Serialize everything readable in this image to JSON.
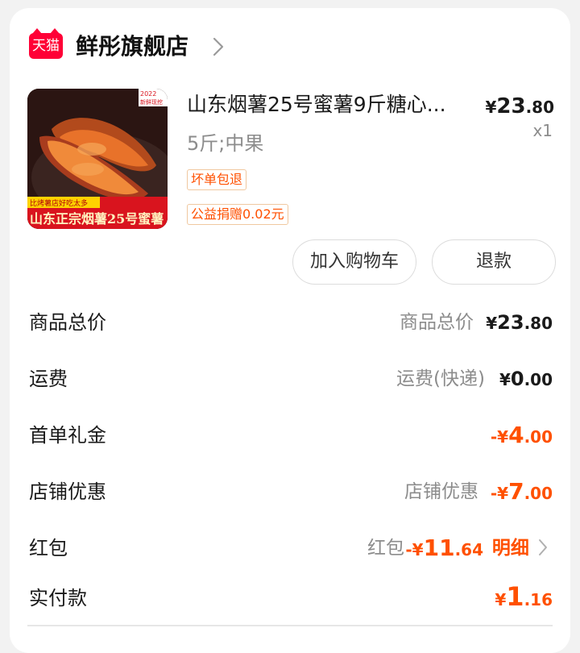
{
  "store": {
    "logo_text": "天猫",
    "name": "鲜彤旗舰店"
  },
  "item": {
    "thumb_year": "2022",
    "thumb_badge": "新鲜现挖",
    "thumb_banner_small": "比烤薯店好吃太多",
    "thumb_banner": "山东正宗烟薯25号蜜薯",
    "title": "山东烟薯25号蜜薯9斤糖心...",
    "spec": "5斤;中果",
    "tags": [
      "坏单包退",
      "公益捐赠0.02元"
    ],
    "price": {
      "sym": "¥",
      "int": "23",
      "dec": ".80"
    },
    "quantity": "x1"
  },
  "actions": {
    "add_to_cart": "加入购物车",
    "refund": "退款"
  },
  "summary": {
    "total": {
      "label": "商品总价",
      "sub": "商品总价",
      "sym": "¥",
      "int": "23",
      "dec": ".80"
    },
    "shipping": {
      "label": "运费",
      "sub": "运费(快递)",
      "sym": "¥",
      "int": "0",
      "dec": ".00"
    },
    "first_order": {
      "label": "首单礼金",
      "sym": "-¥",
      "int": "4",
      "dec": ".00"
    },
    "store_discount": {
      "label": "店铺优惠",
      "sub": "店铺优惠",
      "sym": "-¥",
      "int": "7",
      "dec": ".00"
    },
    "red_packet": {
      "label": "红包",
      "sub": "红包",
      "sym": "-¥",
      "int": "11",
      "dec": ".64",
      "detail": "明细"
    },
    "paid": {
      "label": "实付款",
      "sym": "¥",
      "int": "1",
      "dec": ".16"
    }
  },
  "colors": {
    "accent": "#ff5000",
    "brand_red": "#ff0036",
    "muted": "#8c8c8c"
  },
  "icons": [
    "tmall-logo-icon",
    "chevron-right-icon"
  ]
}
